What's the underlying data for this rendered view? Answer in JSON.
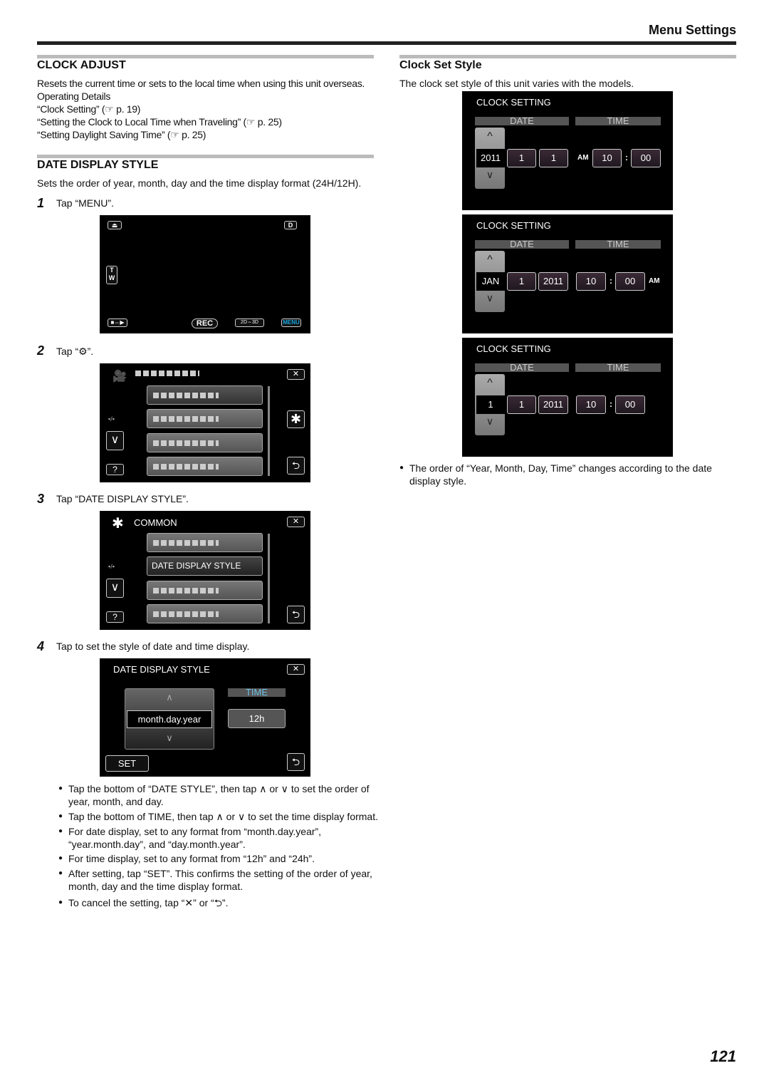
{
  "header": {
    "title": "Menu Settings"
  },
  "page_number": "121",
  "clock_adjust": {
    "title": "CLOCK ADJUST",
    "lines": [
      "Resets the current time or sets to the local time when using this unit overseas.",
      "Operating Details",
      "“Clock Setting” (☞ p. 19)",
      "“Setting the Clock to Local Time when Traveling” (☞ p. 25)",
      "“Setting Daylight Saving Time” (☞ p. 25)"
    ]
  },
  "date_display": {
    "title": "DATE DISPLAY STYLE",
    "desc": "Sets the order of year, month, day and the time display format (24H/12H).",
    "steps": [
      {
        "num": "1",
        "text": "Tap “MENU”."
      },
      {
        "num": "2",
        "text": "Tap “⚙”."
      },
      {
        "num": "3",
        "text": "Tap “DATE DISPLAY STYLE”."
      },
      {
        "num": "4",
        "text": "Tap to set the style of date and time display."
      }
    ],
    "bullets": [
      "Tap the bottom of “DATE STYLE”, then tap ∧ or ∨ to set the order of year, month, and day.",
      "Tap the bottom of TIME, then tap ∧ or ∨ to set the time display format.",
      "For date display, set to any format from “month.day.year”, “year.month.day”, and “day.month.year”.",
      "For time display, set to any format from “12h” and “24h”.",
      "After setting, tap “SET”. This confirms the setting of the order of year, month, day and the time display format.",
      "To cancel the setting, tap “✕” or “⮌”."
    ]
  },
  "screen1": {
    "d": "D",
    "t": "T",
    "w": "W",
    "rec": "REC",
    "mode": "2D⇔3D",
    "menu": "MENU",
    "accent": "#19a6e0"
  },
  "screen3": {
    "title": "COMMON",
    "item": "DATE DISPLAY STYLE"
  },
  "screen4": {
    "title": "DATE DISPLAY STYLE",
    "time_label": "TIME",
    "date_value": "month.day.year",
    "time_value": "12h",
    "set": "SET",
    "time_color": "#6fc3e8"
  },
  "clock_style": {
    "title": "Clock Set Style",
    "desc": "The clock set style of this unit varies with the models.",
    "note": "The order of “Year, Month, Day, Time” changes according to the date display style.",
    "screens": [
      {
        "title": "CLOCK SETTING",
        "date": "DATE",
        "time": "TIME",
        "fields": [
          "2011",
          "1",
          "1",
          "AM",
          "10",
          ":",
          "00"
        ]
      },
      {
        "title": "CLOCK SETTING",
        "date": "DATE",
        "time": "TIME",
        "fields": [
          "JAN",
          "1",
          "2011",
          "10",
          ":",
          "00",
          "AM"
        ]
      },
      {
        "title": "CLOCK SETTING",
        "date": "DATE",
        "time": "TIME",
        "fields": [
          "1",
          "1",
          "2011",
          "10",
          ":",
          "00"
        ]
      }
    ]
  }
}
